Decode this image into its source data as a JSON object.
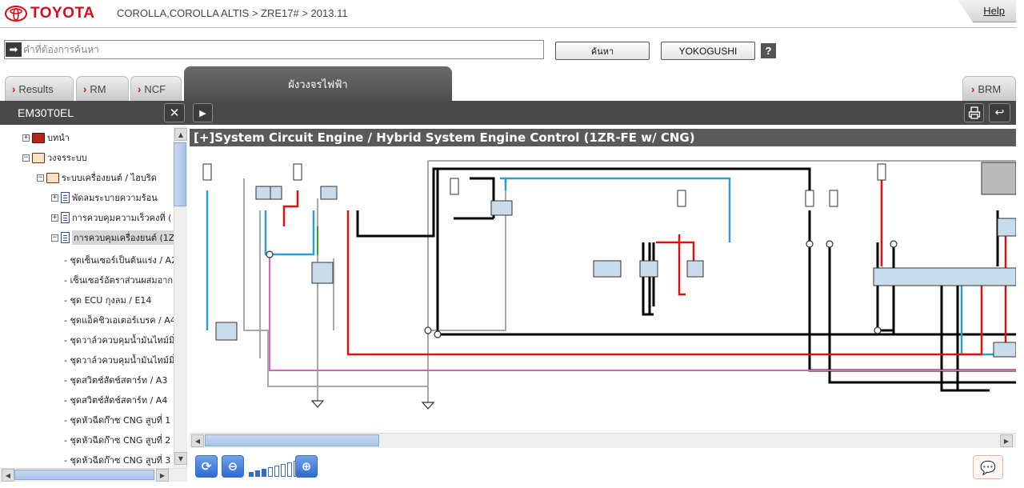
{
  "header": {
    "brand": "TOYOTA",
    "breadcrumb": "COROLLA,COROLLA ALTIS > ZRE17# > 2013.11",
    "help_label": "Help"
  },
  "search": {
    "placeholder": "คำที่ต้องการค้นหา",
    "value": "",
    "search_button": "ค้นหา",
    "yokogushi_button": "YOKOGUSHI",
    "help_icon": "?"
  },
  "tabs": {
    "results": "Results",
    "rm": "RM",
    "ncf": "NCF",
    "diagram": "ผังวงจรไฟฟ้า",
    "brm": "BRM"
  },
  "panel": {
    "title": "EM30T0EL"
  },
  "tree": [
    {
      "label": "บทนำ",
      "icon": "red-book-icon",
      "toggle": "+"
    },
    {
      "label": "วงจรระบบ",
      "icon": "book-icon",
      "toggle": "-"
    },
    {
      "label": "ระบบเครื่องยนต์ / ไฮบริด",
      "icon": "book-icon",
      "toggle": "-"
    },
    {
      "label": "พัดลมระบายความร้อน",
      "icon": "document-icon",
      "toggle": "+"
    },
    {
      "label": "การควบคุมความเร็วคงที่ (",
      "icon": "document-icon",
      "toggle": "+"
    },
    {
      "label": "การควบคุมเครื่องยนต์ (1Z",
      "icon": "document-icon",
      "toggle": "-"
    },
    {
      "label": "- ชุดเซ็นเซอร์เป็นต้นแร่ง / A2"
    },
    {
      "label": "- เซ็นเซอร์อัตราส่วนผสมอากาศ"
    },
    {
      "label": "- ชุด ECU กุงลม / E14"
    },
    {
      "label": "- ชุดแอ็คชิวเอเตอร์เบรค / A4"
    },
    {
      "label": "- ชุดวาล์วควบคุมน้ำมันไทม์มิ่ง"
    },
    {
      "label": "- ชุดวาล์วควบคุมน้ำมันไทม์มิ่ง"
    },
    {
      "label": "- ชุดสวิตช์สัดช์สตาร์ท / A3"
    },
    {
      "label": "- ชุดสวิตช์สัดช์สตาร์ท / A4"
    },
    {
      "label": "- ชุดหัวฉีดก๊าซ CNG สูบที่ 1"
    },
    {
      "label": "- ชุดหัวฉีดก๊าซ CNG สูบที่ 2"
    },
    {
      "label": "- ชุดหัวฉีดก๊าซ CNG สูบที่ 3"
    }
  ],
  "diagram": {
    "title": "[+]System Circuit  Engine / Hybrid System  Engine Control (1ZR-FE w/ CNG)",
    "colors": {
      "black": "#000000",
      "red": "#e01010",
      "blue": "#2a9fd0",
      "pink": "#e060c0",
      "gray": "#a8a8a8",
      "green": "#30a030",
      "component": "#c8dcec"
    }
  },
  "toolbar": {
    "icons": [
      "refresh-icon",
      "zoom-out-icon",
      "zoom-in-icon",
      "comment-icon"
    ],
    "zoom_level": 3,
    "zoom_steps": 8
  },
  "theme": {
    "accent_red": "#d0101b",
    "dark_bar": "#4a4a4a",
    "scroll_thumb": "#a9c3e8"
  }
}
